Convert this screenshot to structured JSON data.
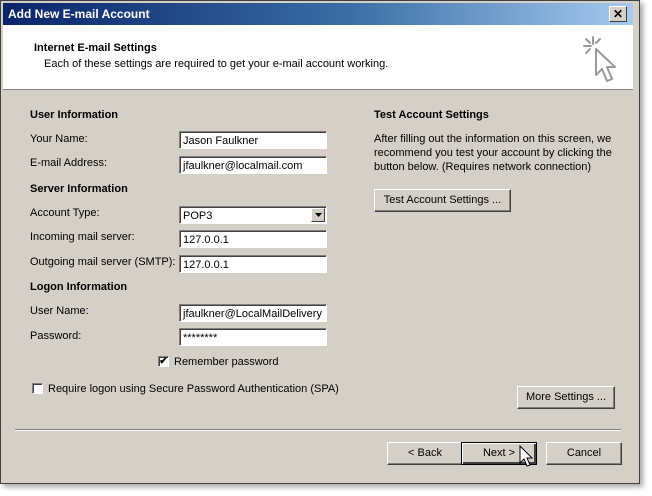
{
  "window": {
    "title": "Add New E-mail Account",
    "close_glyph": "✕"
  },
  "header": {
    "title": "Internet E-mail Settings",
    "subtitle": "Each of these settings are required to get your e-mail account working."
  },
  "user_info": {
    "heading": "User Information",
    "name_label": "Your Name:",
    "name_value": "Jason Faulkner",
    "email_label": "E-mail Address:",
    "email_value": "jfaulkner@localmail.com"
  },
  "server_info": {
    "heading": "Server Information",
    "account_type_label": "Account Type:",
    "account_type_value": "POP3",
    "incoming_label": "Incoming mail server:",
    "incoming_value": "127.0.0.1",
    "outgoing_label": "Outgoing mail server (SMTP):",
    "outgoing_value": "127.0.0.1"
  },
  "logon_info": {
    "heading": "Logon Information",
    "username_label": "User Name:",
    "username_value": "jfaulkner@LocalMailDelivery",
    "password_label": "Password:",
    "password_value": "********",
    "remember_label": "Remember password",
    "remember_checked": true,
    "spa_label": "Require logon using Secure Password Authentication (SPA)",
    "spa_checked": false
  },
  "test_settings": {
    "heading": "Test Account Settings",
    "description": "After filling out the information on this screen, we recommend you test your account by clicking the button below. (Requires network connection)",
    "button_label": "Test Account Settings ..."
  },
  "buttons": {
    "more_settings": "More Settings ...",
    "back": "< Back",
    "next": "Next >",
    "cancel": "Cancel"
  },
  "icons": {
    "wizard": "cursor-sparkle-icon",
    "dropdown": "chevron-down-icon",
    "pointer": "mouse-pointer-icon",
    "checkmark": "✔"
  },
  "colors": {
    "dialog_bg": "#d4d0c8",
    "titlebar_start": "#0a246a",
    "titlebar_end": "#a6caf0"
  }
}
